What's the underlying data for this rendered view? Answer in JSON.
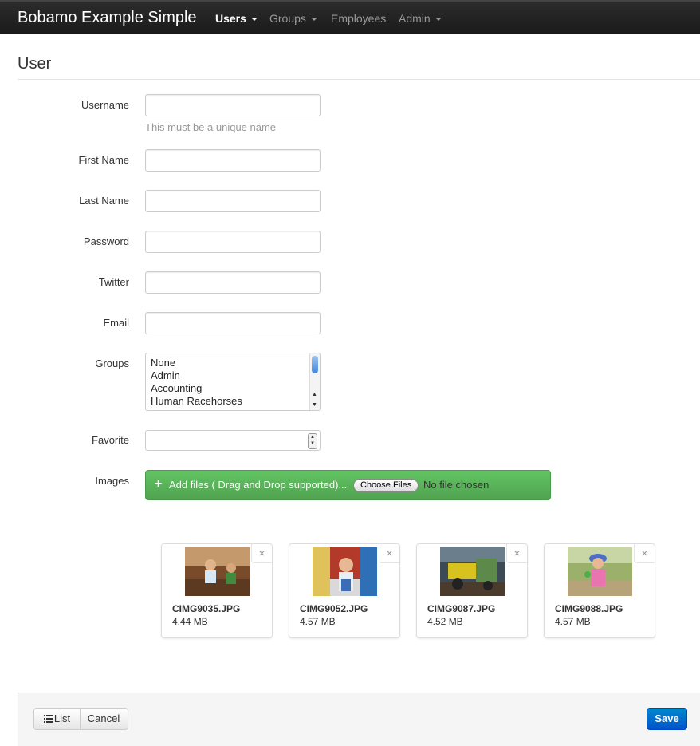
{
  "navbar": {
    "brand": "Bobamo Example Simple",
    "items": [
      {
        "label": "Users",
        "active": true,
        "dropdown": true
      },
      {
        "label": "Groups",
        "active": false,
        "dropdown": true
      },
      {
        "label": "Employees",
        "active": false,
        "dropdown": false
      },
      {
        "label": "Admin",
        "active": false,
        "dropdown": true
      }
    ]
  },
  "page": {
    "title": "User"
  },
  "form": {
    "username": {
      "label": "Username",
      "value": "",
      "help": "This must be a unique name"
    },
    "first_name": {
      "label": "First Name",
      "value": ""
    },
    "last_name": {
      "label": "Last Name",
      "value": ""
    },
    "password": {
      "label": "Password",
      "value": ""
    },
    "twitter": {
      "label": "Twitter",
      "value": ""
    },
    "email": {
      "label": "Email",
      "value": ""
    },
    "groups": {
      "label": "Groups",
      "options": [
        "None",
        "Admin",
        "Accounting",
        "Human Racehorses"
      ]
    },
    "favorite": {
      "label": "Favorite",
      "value": ""
    },
    "images": {
      "label": "Images",
      "add_files_label": "Add files ( Drag and Drop supported)...",
      "choose_files_label": "Choose Files",
      "no_file_label": "No file chosen"
    }
  },
  "thumbnails": [
    {
      "name": "CIMG9035.JPG",
      "size": "4.44 MB",
      "close": "×"
    },
    {
      "name": "CIMG9052.JPG",
      "size": "4.57 MB",
      "close": "×"
    },
    {
      "name": "CIMG9087.JPG",
      "size": "4.52 MB",
      "close": "×"
    },
    {
      "name": "CIMG9088.JPG",
      "size": "4.57 MB",
      "close": "×"
    }
  ],
  "actions": {
    "list_label": "List",
    "cancel_label": "Cancel",
    "save_label": "Save"
  },
  "colors": {
    "success": "#5bb75b",
    "primary": "#0074cc",
    "navbar": "#222222"
  },
  "icons": {
    "add": "plus-icon",
    "list": "list-icon",
    "close": "close-icon"
  }
}
